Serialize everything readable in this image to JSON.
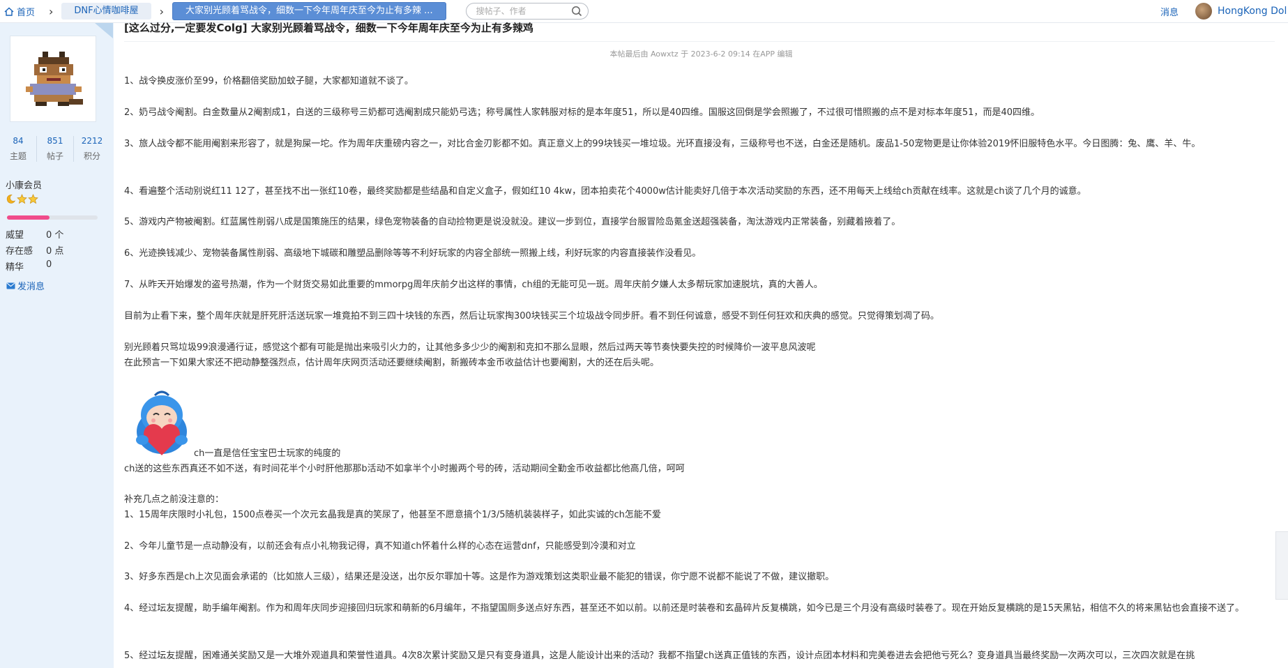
{
  "breadcrumb": {
    "home": "首页",
    "forum": "DNF心情咖啡屋",
    "thread": "大家别光顾着骂战令，细数一下今年周年庆至今为止有多辣 ..."
  },
  "search": {
    "placeholder": "搜帖子、作者"
  },
  "header": {
    "messages": "消息",
    "username": "HongKong Dol"
  },
  "author": {
    "stats": [
      {
        "num": "84",
        "label": "主题"
      },
      {
        "num": "851",
        "label": "帖子"
      },
      {
        "num": "2212",
        "label": "积分"
      }
    ],
    "rank": "小康会员",
    "level_progress": 0.47,
    "props": [
      {
        "label": "威望",
        "value": "0 个"
      },
      {
        "label": "存在感",
        "value": "0 点"
      },
      {
        "label": "精华",
        "value": "0"
      }
    ],
    "send_message": "发消息"
  },
  "post": {
    "title": "[这么过分,一定要发Colg] 大家别光顾着骂战令，细数一下今年周年庆至今为止有多辣鸡",
    "edit_note": "本帖最后由 Aowxtz 于 2023-6-2 09:14 在APP 编辑",
    "paragraphs": [
      "1、战令换皮涨价至99，价格翻倍奖励加蚊子腿，大家都知道就不谈了。",
      "2、奶弓战令阉割。白金数量从2阉割成1，白送的三级称号三奶都可选阉割成只能奶弓选；称号属性人家韩服对标的是本年度51，所以是40四维。国服这回倒是学会照搬了，不过很可惜照搬的点不是对标本年度51，而是40四维。",
      "3、旅人战令都不能用阉割来形容了，就是狗屎一坨。作为周年庆重磅内容之一，对比合金刃影都不如。真正意义上的99块钱买一堆垃圾。光环直接没有，三级称号也不送，白金还是随机。废品1-50宠物更是让你体验2019怀旧服特色水平。今日图腾：兔、鹰、羊、牛。",
      "4、看遍整个活动别说红11 12了，甚至找不出一张红10卷，最终奖励都是些结晶和自定义盒子，假如红10 4kw，团本拍卖花个4000w估计能卖好几倍于本次活动奖励的东西，还不用每天上线给ch贡献在线率。这就是ch谈了几个月的诚意。",
      "5、游戏内产物被阉割。红蓝属性削弱八成是国策施压的结果，绿色宠物装备的自动捡物更是说没就没。建议一步到位，直接学台服冒险岛氪金送超强装备，淘汰游戏内正常装备，别藏着掖着了。",
      "6、光迹换钱减少、宠物装备属性削弱、高级地下城碳和雕塑品删除等等不利好玩家的内容全部统一照搬上线，利好玩家的内容直接装作没看见。",
      "7、从昨天开始爆发的盗号热潮，作为一个财货交易如此重要的mmorpg周年庆前夕出这样的事情，ch组的无能可见一斑。周年庆前夕嫌人太多帮玩家加速脱坑，真的大善人。",
      "目前为止看下来，整个周年庆就是肝死肝活送玩家一堆竟拍不到三四十块钱的东西，然后让玩家掏300块钱买三个垃圾战令同步肝。看不到任何诚意，感受不到任何狂欢和庆典的感觉。只觉得策划凋了码。",
      "别光顾着只骂垃圾99浪漫通行证，感觉这个都有可能是抛出来吸引火力的，让其他多多少少的阉割和克扣不那么显眼，然后过两天等节奏快要失控的时候降价一波平息风波呢",
      "在此预言一下如果大家还不把动静整强烈点，估计周年庆网页活动还要继续阉割，新搬砖本金币收益估计也要阉割，大的还在后头呢。",
      "ch一直是信任宝宝巴士玩家的纯度的",
      "ch送的这些东西真还不如不送，有时间花半个小时肝他那那b活动不如拿半个小时搬两个号的砖，活动期间全勤金币收益都比他高几倍，呵呵",
      "补充几点之前没注意的：",
      "1、15周年庆限时小礼包，1500点卷买一个次元玄晶我是真的笑尿了，他甚至不愿意搞个1/3/5随机装装样子，如此实诚的ch怎能不爱",
      "2、今年儿童节是一点动静没有，以前还会有点小礼物我记得，真不知道ch怀着什么样的心态在运营dnf，只能感受到冷漠和对立",
      "3、好多东西是ch上次见面会承诺的（比如旅人三级），结果还是没送，出尔反尔罪加十等。这是作为游戏策划这类职业最不能犯的错误，你宁愿不说都不能说了不做，建议撤职。",
      "4、经过坛友提醒，助手编年阉割。作为和周年庆同步迎接回归玩家和萌新的6月编年，不指望国厕多送点好东西，甚至还不如以前。以前还是时装卷和玄晶碎片反复横跳，如今已是三个月没有高级时装卷了。现在开始反复横跳的是15天黑钻，相信不久的将来黑钻也会直接不送了。",
      "5、经过坛友提醒，困难通关奖励又是一大堆外观道具和荣誉性道具。4次8次累计奖励又是只有变身道具，这是人能设计出来的活动？我都不指望ch送真正值钱的东西，设计点团本材料和完美卷进去会把他亏死么？变身道具当最终奖励一次两次可以，三次四次就是在挑"
    ]
  }
}
